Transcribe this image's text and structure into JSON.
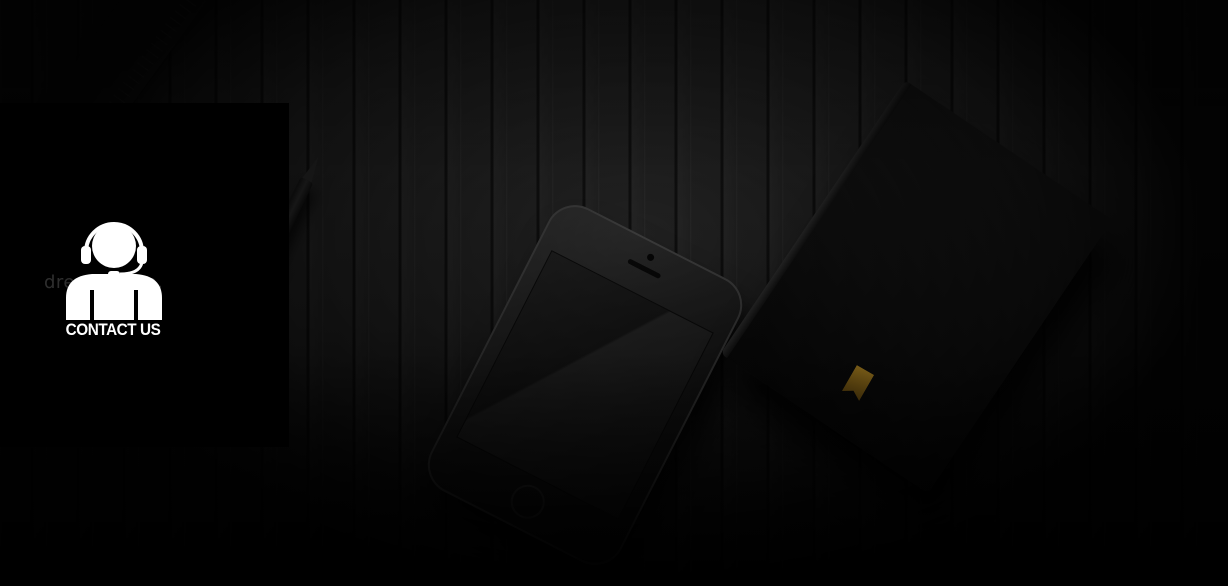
{
  "contact": {
    "label": "CONTACT US",
    "icon": "support-headset-person-icon"
  },
  "watermark": {
    "text": "dreamstime."
  },
  "colors": {
    "panel": "#000000",
    "label": "#ffffff",
    "bookmark": "#d9a52a"
  }
}
